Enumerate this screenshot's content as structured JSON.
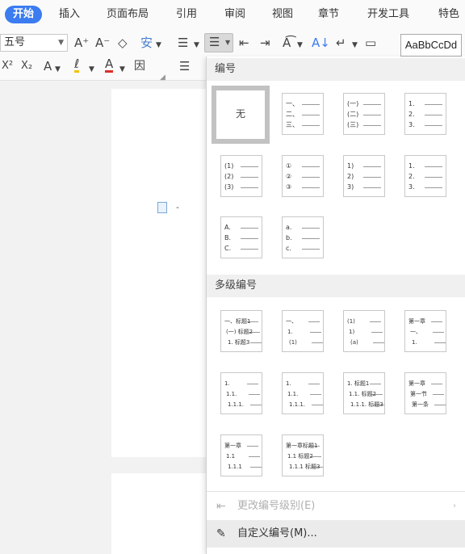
{
  "tabs": [
    {
      "label": "开始",
      "active": true
    },
    {
      "label": "插入"
    },
    {
      "label": "页面布局"
    },
    {
      "label": "引用"
    },
    {
      "label": "审阅"
    },
    {
      "label": "视图"
    },
    {
      "label": "章节"
    },
    {
      "label": "开发工具"
    },
    {
      "label": "特色"
    }
  ],
  "ribbon": {
    "font_size": "五号",
    "grow_font_glyph": "A⁺",
    "shrink_font_glyph": "A⁻",
    "clear_format_glyph": "◇",
    "phonetic_glyph": "安",
    "superscript_glyph": "X²",
    "subscript_glyph": "X₂",
    "text_effect_glyph": "A",
    "highlight_glyph": "ℓ",
    "font_color_glyph": "A",
    "char_border_glyph": "因",
    "style_preview": "AaBbCcDd"
  },
  "colors": {
    "accent": "#3b7cf0",
    "highlight": "#f2c200",
    "font_color": "#d9302b"
  },
  "panel": {
    "numbering_header": "编号",
    "none_label": "无",
    "numbering_samples": [
      [
        "一、",
        "二、",
        "三、"
      ],
      [
        "(一)",
        "(二)",
        "(三)"
      ],
      [
        "1.",
        "2.",
        "3."
      ],
      [
        "(1)",
        "(2)",
        "(3)"
      ],
      [
        "①",
        "②",
        "③"
      ],
      [
        "1)",
        "2)",
        "3)"
      ],
      [
        "1.",
        "2.",
        "3."
      ],
      [
        "A.",
        "B.",
        "C."
      ],
      [
        "a.",
        "b.",
        "c."
      ]
    ],
    "multilevel_header": "多级编号",
    "multilevel_samples": [
      [
        "一、标题1",
        "(一) 标题2",
        "1. 标题3"
      ],
      [
        "一、",
        "1.",
        "(1)"
      ],
      [
        "(1)",
        "1)",
        "(a)"
      ],
      [
        "第一章",
        "一、",
        "1."
      ],
      [
        "1.",
        "1.1.",
        "1.1.1."
      ],
      [
        "1.",
        "1.1.",
        "1.1.1."
      ],
      [
        "1. 标题1",
        "1.1. 标题2",
        "1.1.1. 标题3"
      ],
      [
        "第一章",
        "第一节",
        "第一条"
      ],
      [
        "第一章",
        "1.1",
        "1.1.1"
      ],
      [
        "第一章标题1",
        "1.1 标题2",
        "1.1.1 标题3"
      ]
    ],
    "change_level_label": "更改编号级别(E)",
    "custom_label": "自定义编号(M)..."
  }
}
